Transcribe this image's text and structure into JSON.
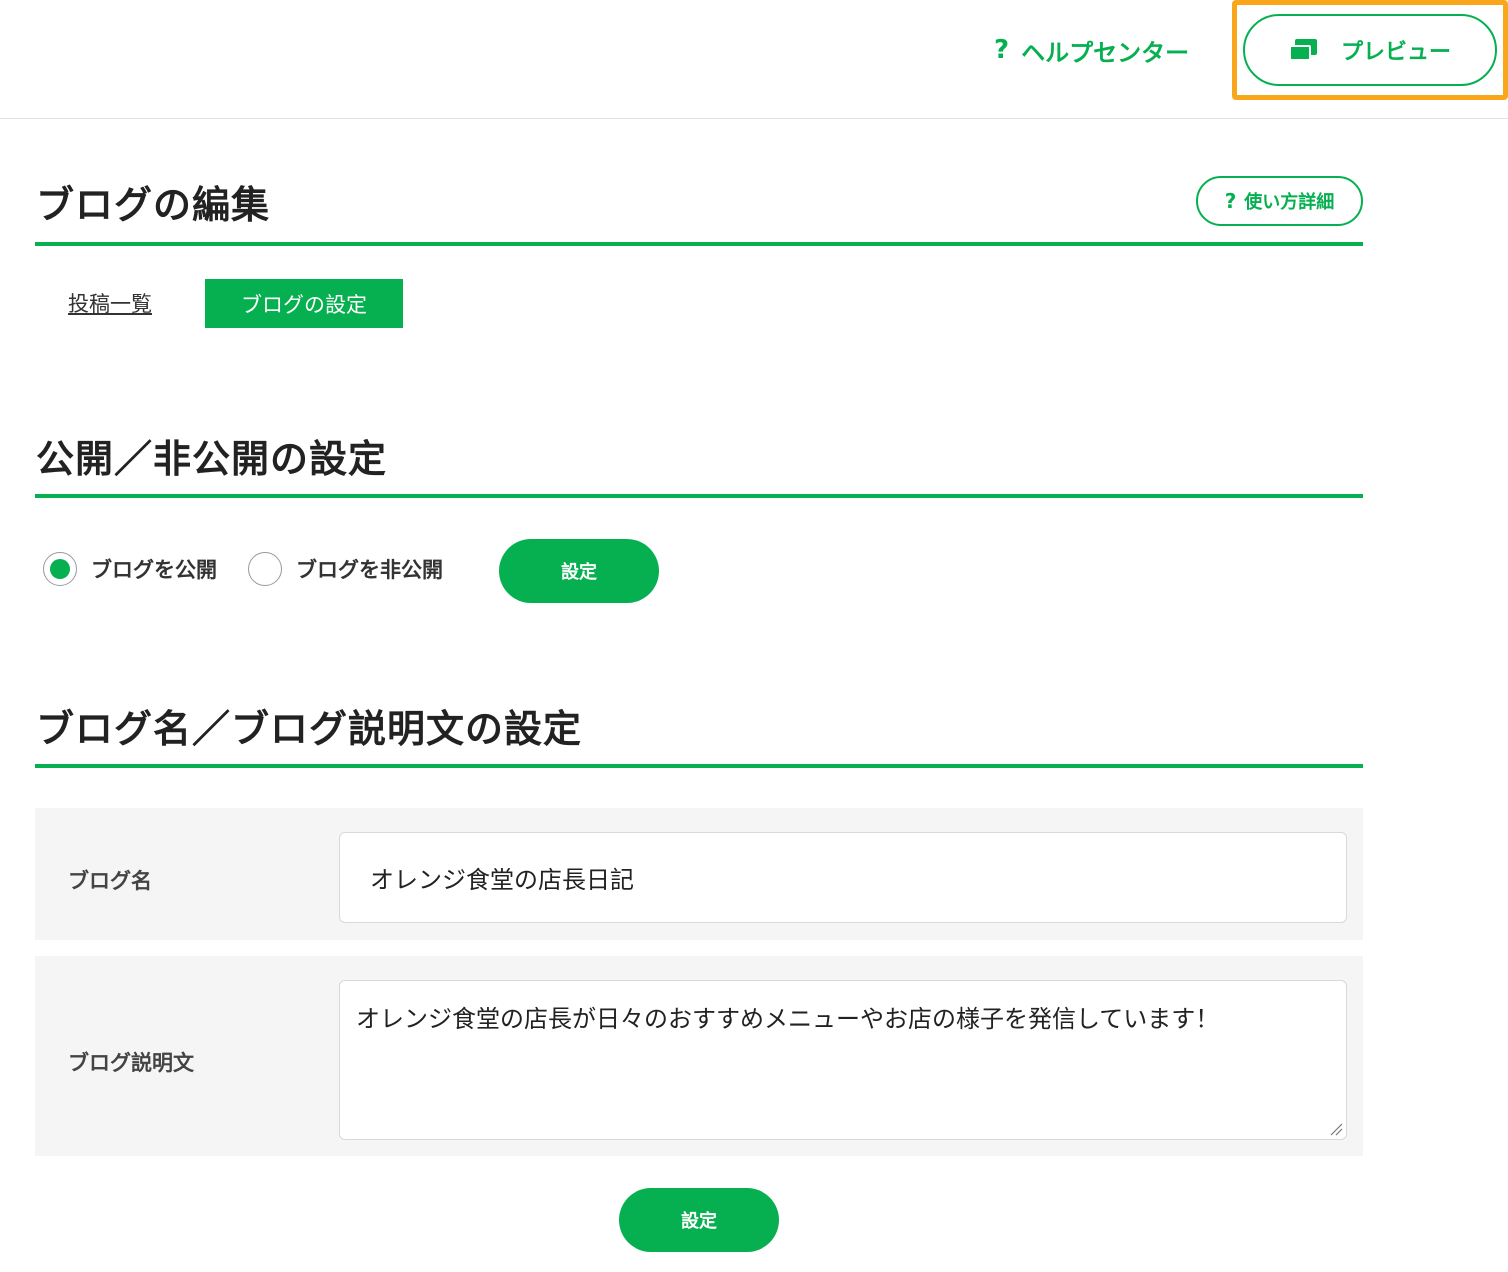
{
  "header": {
    "help_icon": "?",
    "help_label": "ヘルプセンター",
    "preview_icon": "preview-icon",
    "preview_label": "プレビュー",
    "highlight_color": "#f9a61a"
  },
  "page": {
    "title": "ブログの編集",
    "usage_icon": "?",
    "usage_label": "使い方詳細",
    "accent_color": "#06b050"
  },
  "tabs": [
    {
      "label": "投稿一覧",
      "active": false
    },
    {
      "label": "ブログの設定",
      "active": true
    }
  ],
  "visibility_section": {
    "title": "公開／非公開の設定",
    "options": [
      {
        "label": "ブログを公開",
        "selected": true
      },
      {
        "label": "ブログを非公開",
        "selected": false
      }
    ],
    "submit_label": "設定"
  },
  "name_section": {
    "title": "ブログ名／ブログ説明文の設定",
    "blog_name_label": "ブログ名",
    "blog_name_value": "オレンジ食堂の店長日記",
    "blog_description_label": "ブログ説明文",
    "blog_description_value": "オレンジ食堂の店長が日々のおすすめメニューやお店の様子を発信しています！",
    "submit_label": "設定"
  }
}
